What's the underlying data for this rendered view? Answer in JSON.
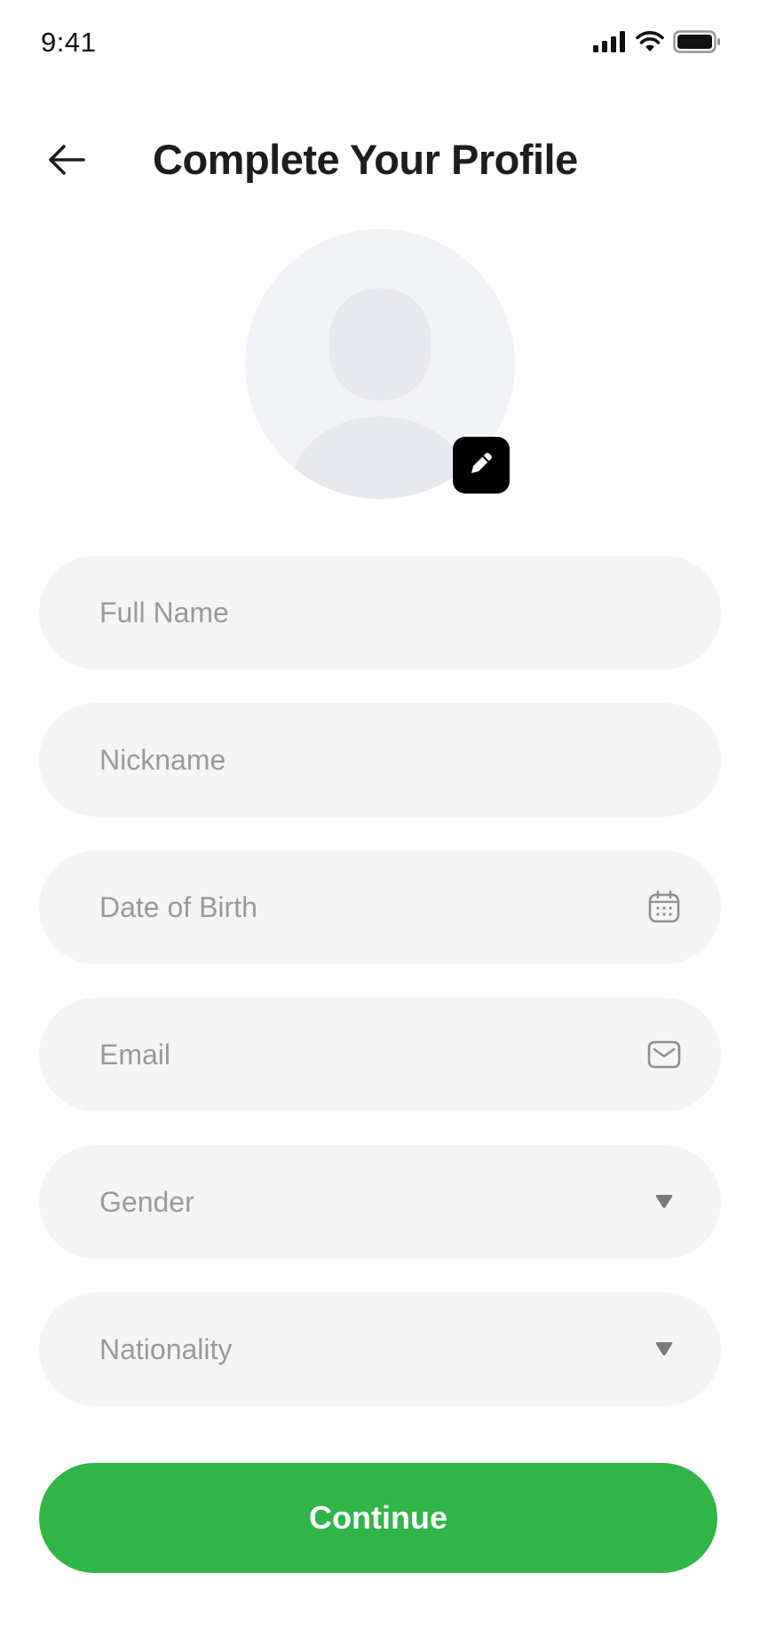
{
  "status_bar": {
    "time": "9:41",
    "icons": [
      "cellular-signal-icon",
      "wifi-icon",
      "battery-icon"
    ]
  },
  "header": {
    "back_icon": "arrow-left-icon",
    "title": "Complete Your Profile"
  },
  "avatar": {
    "edit_icon": "pencil-icon"
  },
  "form": {
    "full_name": {
      "placeholder": "Full Name"
    },
    "nickname": {
      "placeholder": "Nickname"
    },
    "date_of_birth": {
      "placeholder": "Date of Birth",
      "icon": "calendar-icon"
    },
    "email": {
      "placeholder": "Email",
      "icon": "mail-icon"
    },
    "gender": {
      "placeholder": "Gender",
      "icon": "caret-down-icon"
    },
    "nationality": {
      "placeholder": "Nationality",
      "icon": "caret-down-icon"
    }
  },
  "continue_button": {
    "label": "Continue"
  },
  "colors": {
    "accent": "#32b548",
    "field_background": "#f5f5f5",
    "placeholder": "#9a9a9a",
    "title": "#1d1d1f"
  }
}
